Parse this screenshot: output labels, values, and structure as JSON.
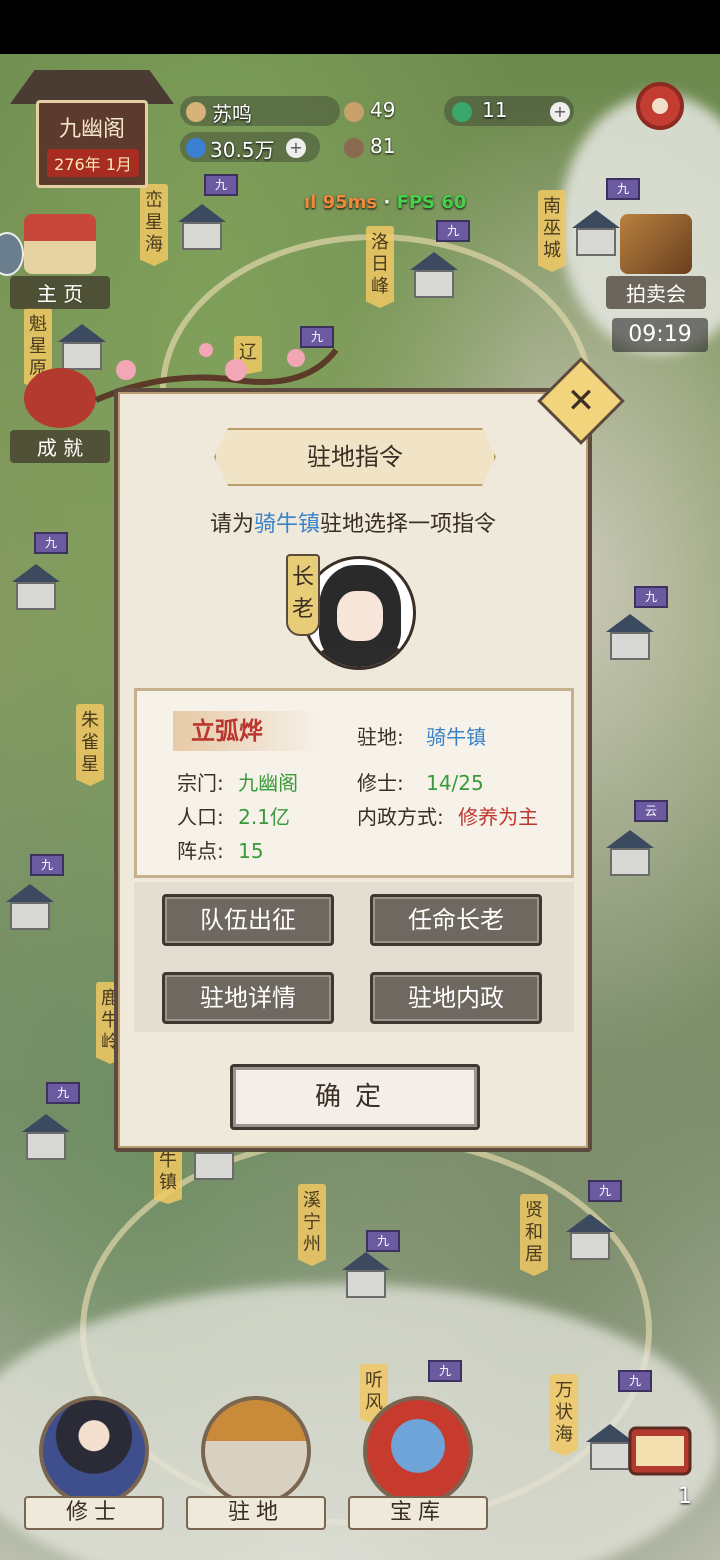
{
  "sect": {
    "name": "九幽阁",
    "date": "276年 1月"
  },
  "player": {
    "name": "苏鸣",
    "spirit_stones": "30.5万",
    "resource_a": "49",
    "resource_b": "81",
    "jade": "11"
  },
  "net": {
    "ping": "95ms",
    "separator": "·",
    "fps": "FPS 60"
  },
  "side_left": [
    {
      "label": "主 页"
    },
    {
      "label": "成 就"
    }
  ],
  "side_right": {
    "auction_label": "拍卖会",
    "timer": "09:19"
  },
  "map_labels": [
    "峦星海",
    "洛日峰",
    "南巫城",
    "魁星原",
    "朱雀星",
    "溪宁州",
    "贤和居",
    "听风",
    "万状海",
    "牛镇",
    "辽",
    "鹿牛岭"
  ],
  "flag_char": "九",
  "flag_char_alt": "云",
  "dialog": {
    "title": "驻地指令",
    "prompt_prefix": "请为",
    "prompt_place": "骑牛镇",
    "prompt_suffix": "驻地选择一项指令",
    "rank_tag": "长老",
    "governor": "立弧烨",
    "station_label": "驻地:",
    "station_value": "骑牛镇",
    "sect_label": "宗门:",
    "sect_value": "九幽阁",
    "cultivators_label": "修士:",
    "cultivators_value": "14/25",
    "population_label": "人口:",
    "population_value": "2.1亿",
    "policy_label": "内政方式:",
    "policy_value": "修养为主",
    "formation_label": "阵点:",
    "formation_value": "15",
    "actions": [
      "队伍出征",
      "任命长老",
      "驻地详情",
      "驻地内政"
    ],
    "confirm": "确定",
    "close": "✕"
  },
  "bottom_nav": [
    {
      "label": "修士"
    },
    {
      "label": "驻地"
    },
    {
      "label": "宝库"
    }
  ],
  "scroll_count": "1",
  "colors": {
    "accent_red": "#c0362f",
    "accent_blue": "#3a83c9",
    "accent_green": "#3a9a3a",
    "panel": "#efe9dc"
  }
}
